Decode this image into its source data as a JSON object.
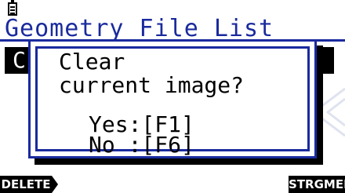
{
  "status_bar": {
    "battery_icon": "battery-icon"
  },
  "app": {
    "title": "Geometry File List",
    "selected_row_label": "C"
  },
  "dialog": {
    "message_line_1": "Clear",
    "message_line_2": "current image?",
    "yes_option": "Yes:[F1]",
    "no_option": "No :[F6]"
  },
  "function_keys": {
    "f1_label": "DELETE",
    "f6_label": "STRGMEM"
  },
  "colors": {
    "accent": "#1a2a9e",
    "background": "#ffffff",
    "highlight": "#000000"
  }
}
